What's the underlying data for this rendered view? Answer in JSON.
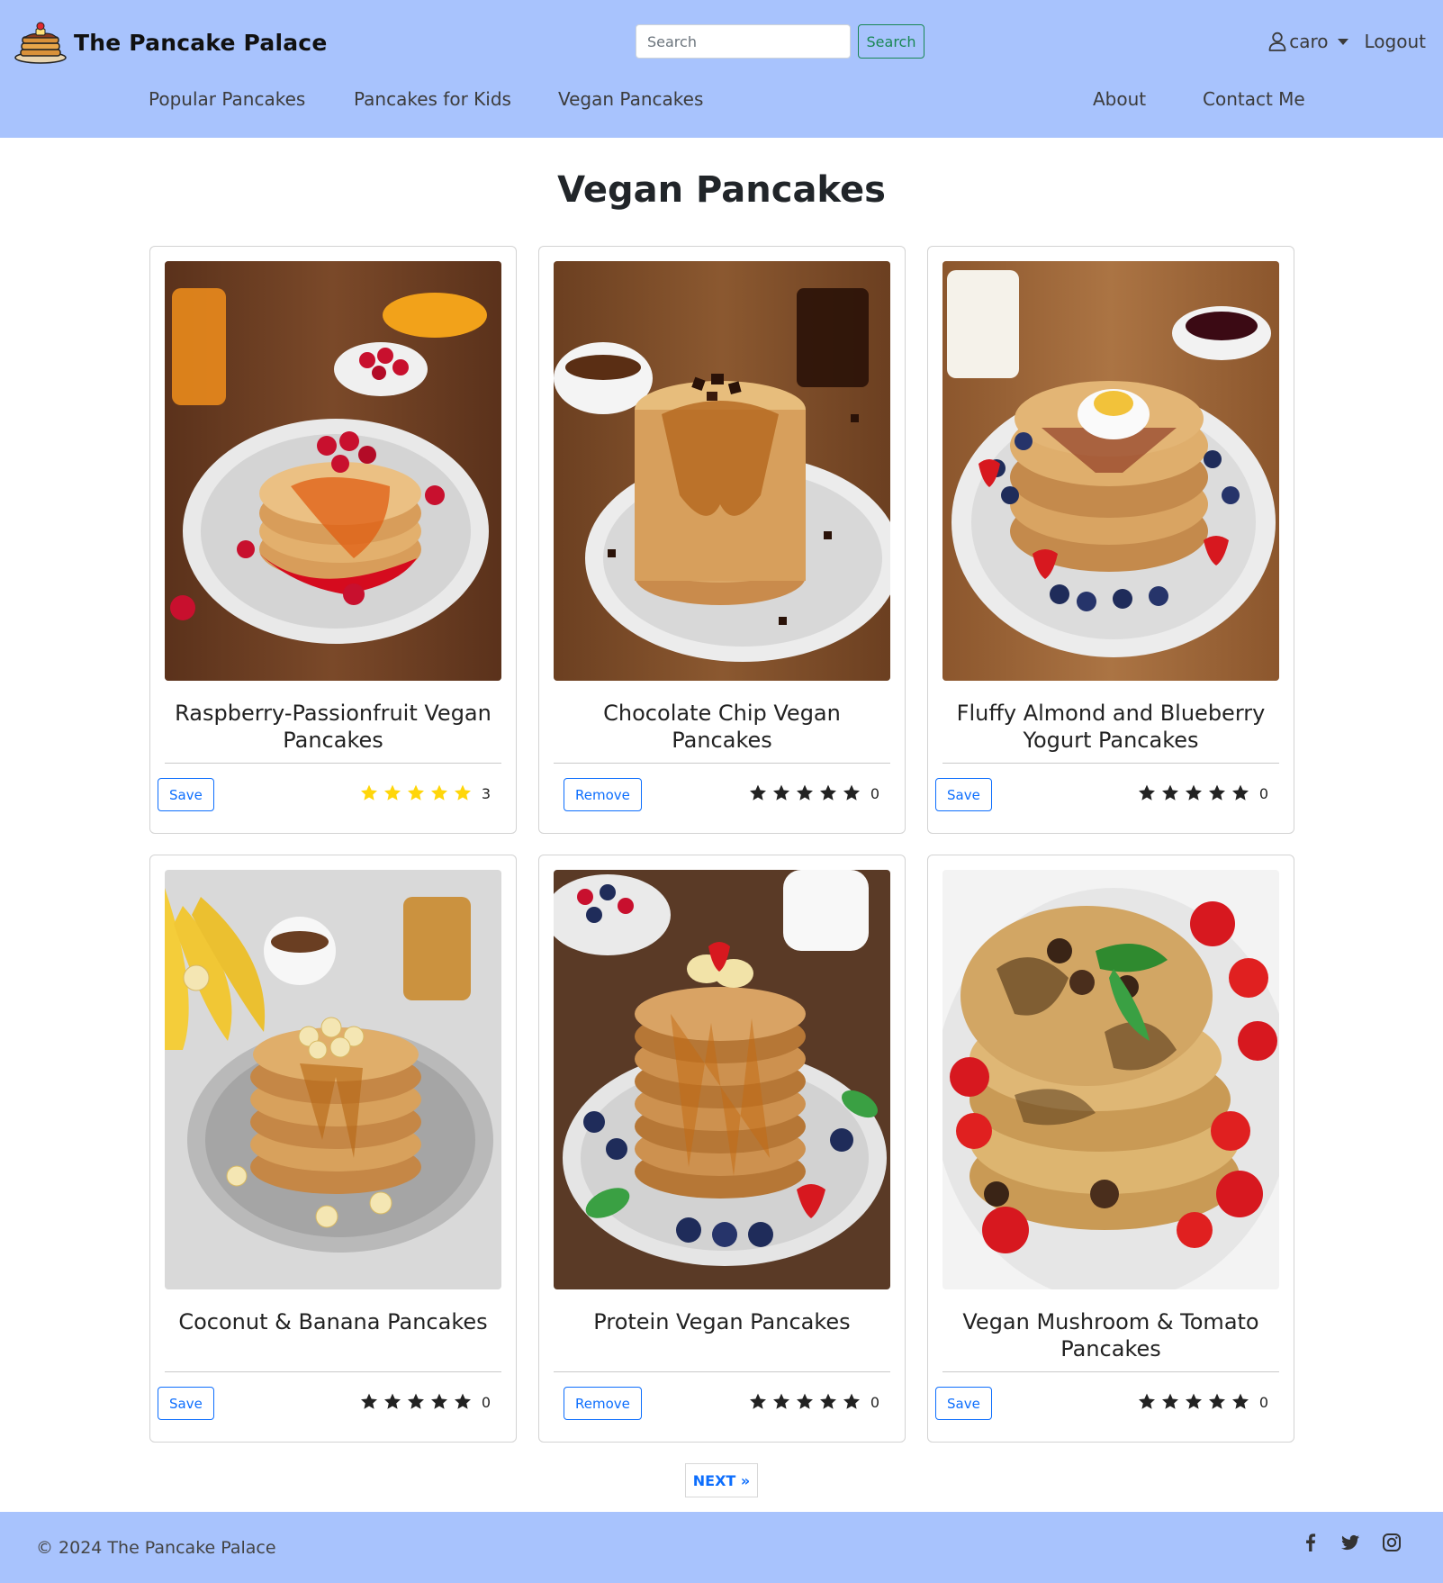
{
  "header": {
    "brand_name": "The Pancake Palace",
    "search": {
      "placeholder": "Search",
      "button_label": "Search"
    },
    "user": {
      "name": "caro",
      "logout_label": "Logout"
    },
    "nav_left": [
      "Popular Pancakes",
      "Pancakes for Kids",
      "Vegan Pancakes"
    ],
    "nav_right": [
      "About",
      "Contact Me"
    ]
  },
  "main": {
    "title": "Vegan Pancakes",
    "cards": [
      {
        "title": "Raspberry-Passionfruit Vegan Pancakes",
        "action": "Save",
        "rating": 5,
        "rated": true,
        "count": "3"
      },
      {
        "title": "Chocolate Chip Vegan Pancakes",
        "action": "Remove",
        "rating": 0,
        "rated": false,
        "count": "0"
      },
      {
        "title": "Fluffy Almond and Blueberry Yogurt Pancakes",
        "action": "Save",
        "rating": 0,
        "rated": false,
        "count": "0"
      },
      {
        "title": "Coconut & Banana Pancakes",
        "action": "Save",
        "rating": 0,
        "rated": false,
        "count": "0"
      },
      {
        "title": "Protein Vegan Pancakes",
        "action": "Remove",
        "rating": 0,
        "rated": false,
        "count": "0"
      },
      {
        "title": "Vegan Mushroom & Tomato Pancakes",
        "action": "Save",
        "rating": 0,
        "rated": false,
        "count": "0"
      }
    ],
    "pagination": {
      "next_label": "NEXT »"
    }
  },
  "footer": {
    "copyright": "© 2024 The Pancake Palace",
    "social_icons": [
      "facebook-icon",
      "twitter-icon",
      "instagram-icon"
    ]
  },
  "colors": {
    "header_bg": "#a8c3fd",
    "primary": "#0d6efd",
    "success": "#198754",
    "star_filled": "#ffd60a",
    "star_empty": "#222222"
  }
}
